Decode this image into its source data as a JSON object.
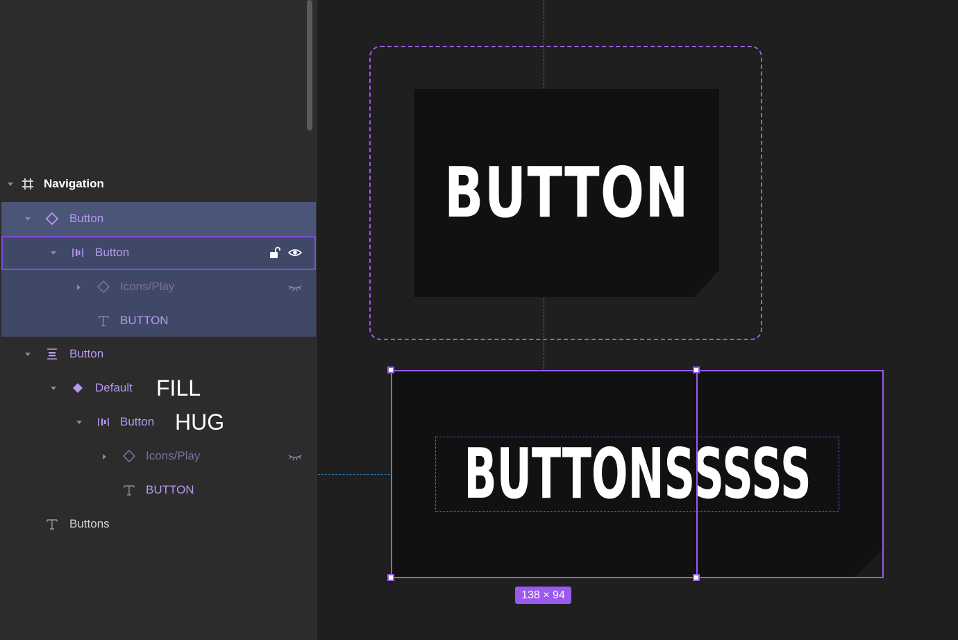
{
  "layers": [
    {
      "label": "Navigation",
      "icon": "frame-icon"
    },
    {
      "label": "Button",
      "icon": "component-icon",
      "selected": true
    },
    {
      "label": "Button",
      "icon": "auto-layout-horizontal-icon",
      "locked": false,
      "visible": true
    },
    {
      "label": "Icons/Play",
      "icon": "instance-icon",
      "hidden": true
    },
    {
      "label": "BUTTON",
      "icon": "text-icon"
    },
    {
      "label": "Button",
      "icon": "auto-layout-vertical-icon"
    },
    {
      "label": "Default",
      "icon": "variant-icon"
    },
    {
      "label": "Button",
      "icon": "auto-layout-horizontal-icon"
    },
    {
      "label": "Icons/Play",
      "icon": "instance-icon",
      "hidden": true
    },
    {
      "label": "BUTTON",
      "icon": "text-icon"
    },
    {
      "label": "Buttons",
      "icon": "text-icon"
    }
  ],
  "annotations": {
    "fill": "FILL",
    "hug": "HUG"
  },
  "canvas": {
    "component_button_text": "BUTTON",
    "instance_button_text": "BUTTONSSSSS",
    "size_badge": "138 × 94"
  },
  "colors": {
    "selection": "#9b59f0",
    "component_purple": "#b79af0",
    "layer_selected_bg": "#4a5578",
    "guide": "#2a7fb8"
  }
}
